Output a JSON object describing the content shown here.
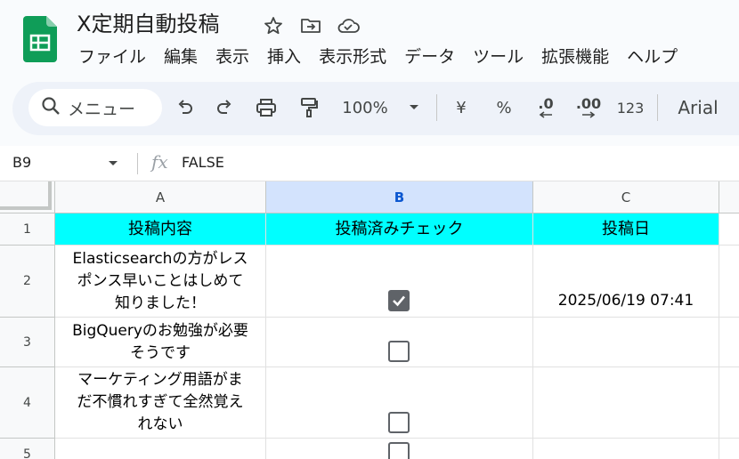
{
  "doc": {
    "title": "X定期自動投稿"
  },
  "menu": [
    "ファイル",
    "編集",
    "表示",
    "挿入",
    "表示形式",
    "データ",
    "ツール",
    "拡張機能",
    "ヘルプ"
  ],
  "toolbar": {
    "search_label": "メニュー",
    "zoom": "100%",
    "currency": "¥",
    "percent": "%",
    "decrease_decimal": ".0",
    "increase_decimal": ".00",
    "number_format": "123",
    "font": "Arial"
  },
  "formula_bar": {
    "cell_ref": "B9",
    "fx": "fx",
    "value": "FALSE"
  },
  "columns": [
    "A",
    "B",
    "C"
  ],
  "rows": [
    "1",
    "2",
    "3",
    "4",
    "5"
  ],
  "header_row": {
    "a": "投稿内容",
    "b": "投稿済みチェック",
    "c": "投稿日"
  },
  "data_rows": [
    {
      "a": [
        "Elasticsearchの方がレス",
        "ポンス早いことはしめて",
        "知りました！"
      ],
      "checked": true,
      "c": "2025/06/19 07:41"
    },
    {
      "a": [
        "BigQueryのお勉強が必要",
        "そうです"
      ],
      "checked": false,
      "c": ""
    },
    {
      "a": [
        "マーケティング用語がま",
        "だ不慣れすぎて全然覚え",
        "れない"
      ],
      "checked": false,
      "c": ""
    },
    {
      "a": [],
      "checked": false,
      "c": ""
    }
  ],
  "colors": {
    "header_fill": "#00ffff",
    "selected_col": "#d3e3fd",
    "logo_green": "#0f9d58"
  }
}
